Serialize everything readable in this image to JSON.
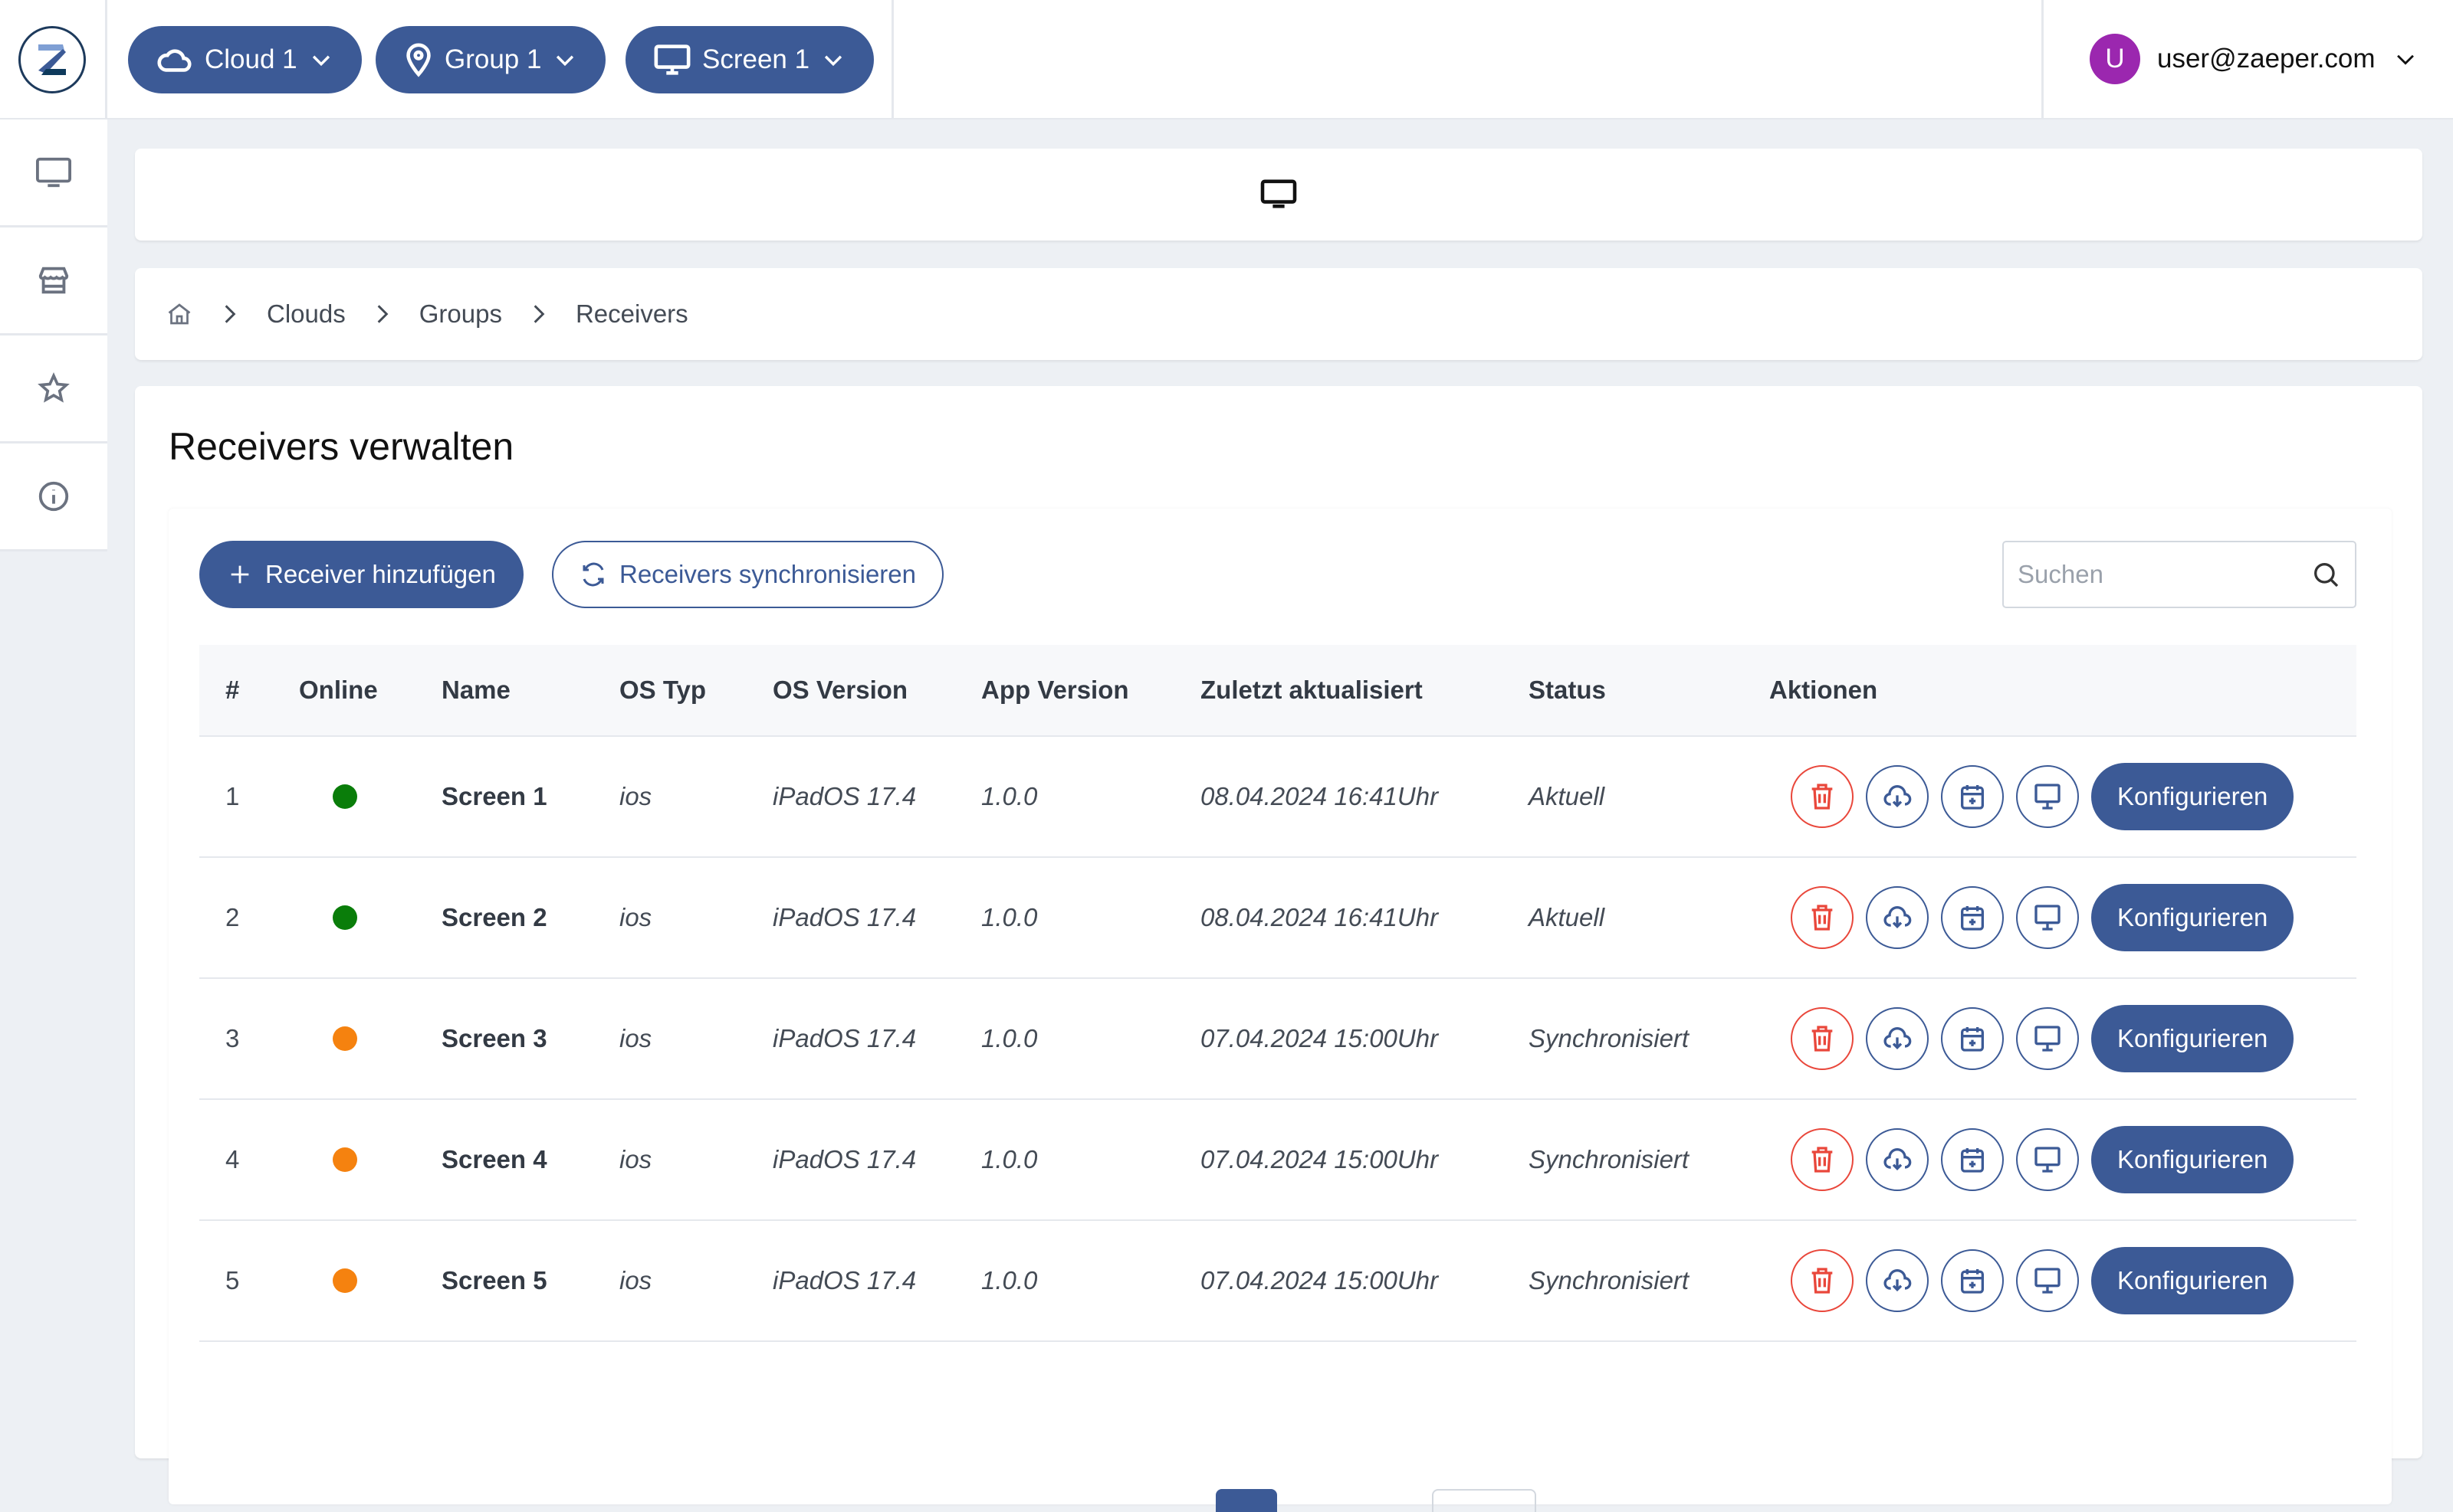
{
  "header": {
    "logo_letter": "Z",
    "selectors": [
      {
        "icon": "cloud-icon",
        "label": "Cloud 1"
      },
      {
        "icon": "map-pin-icon",
        "label": "Group 1"
      },
      {
        "icon": "monitor-icon",
        "label": "Screen 1"
      }
    ],
    "user": {
      "initial": "U",
      "email": "user@zaeper.com"
    }
  },
  "sidebar": {
    "items": [
      {
        "icon": "monitor-icon",
        "name": "screens"
      },
      {
        "icon": "store-icon",
        "name": "store"
      },
      {
        "icon": "star-icon",
        "name": "favorites"
      },
      {
        "icon": "info-icon",
        "name": "info"
      }
    ]
  },
  "breadcrumb": [
    "Clouds",
    "Groups",
    "Receivers"
  ],
  "main": {
    "title": "Receivers verwalten",
    "add_button": "Receiver hinzufügen",
    "sync_button": "Receivers synchronisieren",
    "search_placeholder": "Suchen",
    "columns": [
      "#",
      "Online",
      "Name",
      "OS Typ",
      "OS Version",
      "App Version",
      "Zuletzt aktualisiert",
      "Status",
      "Aktionen"
    ],
    "configure_label": "Konfigurieren",
    "rows": [
      {
        "num": "1",
        "online": "#0a7d0a",
        "name": "Screen 1",
        "os": "ios",
        "os_version": "iPadOS 17.4",
        "app_version": "1.0.0",
        "updated": "08.04.2024 16:41Uhr",
        "status": "Aktuell"
      },
      {
        "num": "2",
        "online": "#0a7d0a",
        "name": "Screen 2",
        "os": "ios",
        "os_version": "iPadOS 17.4",
        "app_version": "1.0.0",
        "updated": "08.04.2024 16:41Uhr",
        "status": "Aktuell"
      },
      {
        "num": "3",
        "online": "#f5820f",
        "name": "Screen 3",
        "os": "ios",
        "os_version": "iPadOS 17.4",
        "app_version": "1.0.0",
        "updated": "07.04.2024 15:00Uhr",
        "status": "Synchronisiert"
      },
      {
        "num": "4",
        "online": "#f5820f",
        "name": "Screen 4",
        "os": "ios",
        "os_version": "iPadOS 17.4",
        "app_version": "1.0.0",
        "updated": "07.04.2024 15:00Uhr",
        "status": "Synchronisiert"
      },
      {
        "num": "5",
        "online": "#f5820f",
        "name": "Screen 5",
        "os": "ios",
        "os_version": "iPadOS 17.4",
        "app_version": "1.0.0",
        "updated": "07.04.2024 15:00Uhr",
        "status": "Synchronisiert"
      }
    ]
  },
  "colors": {
    "primary": "#3c5a96",
    "danger": "#e9473b",
    "online": "#0a7d0a",
    "pending": "#f5820f",
    "avatar": "#9b27af"
  }
}
